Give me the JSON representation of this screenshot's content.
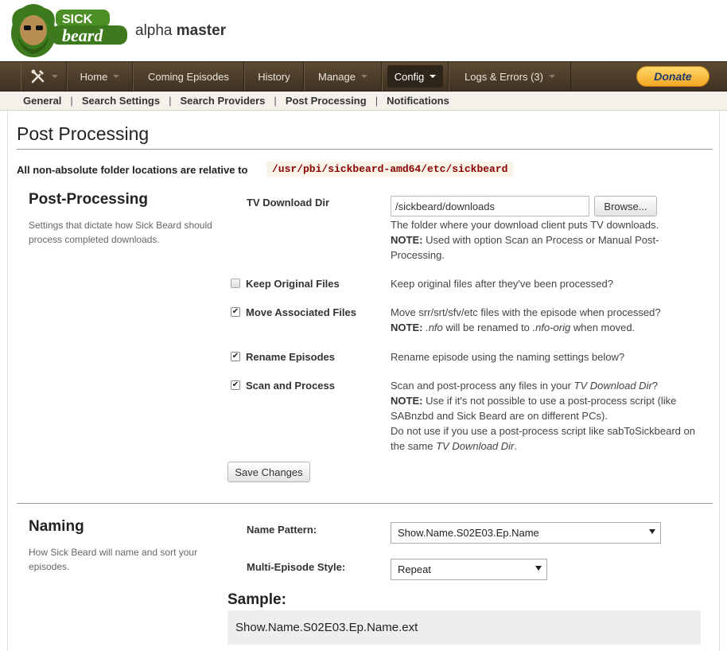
{
  "header": {
    "logo_text_top": "SICK",
    "logo_text_bottom": "beard",
    "branch_prefix": "alpha",
    "branch_name": "master"
  },
  "nav": {
    "items": [
      {
        "label": "Home"
      },
      {
        "label": "Coming Episodes"
      },
      {
        "label": "History"
      },
      {
        "label": "Manage"
      },
      {
        "label": "Config"
      },
      {
        "label": "Logs & Errors (3)"
      }
    ],
    "donate_label": "Donate"
  },
  "subnav": {
    "items": [
      "General",
      "Search Settings",
      "Search Providers",
      "Post Processing",
      "Notifications"
    ],
    "separator": "|"
  },
  "page": {
    "title": "Post Processing",
    "relative_note": "All non-absolute folder locations are relative to",
    "relative_path": "/usr/pbi/sickbeard-amd64/etc/sickbeard"
  },
  "post_processing": {
    "title": "Post-Processing",
    "description": "Settings that dictate how Sick Beard should process completed downloads.",
    "tv_download_dir": {
      "label": "TV Download Dir",
      "value": "/sickbeard/downloads",
      "browse_label": "Browse...",
      "help": "The folder where your download client puts TV downloads.",
      "note_label": "NOTE:",
      "note": "Used with option Scan an Process or Manual Post-Processing."
    },
    "keep_original": {
      "label": "Keep Original Files",
      "checked": false,
      "help": "Keep original files after they've been processed?"
    },
    "move_associated": {
      "label": "Move Associated Files",
      "checked": true,
      "help": "Move srr/srt/sfv/etc files with the episode when processed?",
      "note_label": "NOTE:",
      "note_ext1": ".nfo",
      "note_mid": "will be renamed to",
      "note_ext2": ".nfo-orig",
      "note_end": "when moved."
    },
    "rename_episodes": {
      "label": "Rename Episodes",
      "checked": true,
      "help": "Rename episode using the naming settings below?"
    },
    "scan_and_process": {
      "label": "Scan and Process",
      "checked": true,
      "help_prefix": "Scan and post-process any files in your",
      "help_dir": "TV Download Dir",
      "help_suffix": "?",
      "note_label": "NOTE:",
      "note": "Use if it's not possible to use a post-process script (like SABnzbd and Sick Beard are on different PCs).",
      "note2_prefix": "Do not use if you use a post-process script like sabToSickbeard on the same",
      "note2_dir": "TV Download Dir",
      "note2_suffix": "."
    },
    "save_label": "Save Changes"
  },
  "naming": {
    "title": "Naming",
    "description": "How Sick Beard will name and sort your episodes.",
    "name_pattern": {
      "label": "Name Pattern:",
      "value": "Show.Name.S02E03.Ep.Name"
    },
    "multi_episode_style": {
      "label": "Multi-Episode Style:",
      "value": "Repeat"
    },
    "sample_title": "Sample:",
    "sample_value": "Show.Name.S02E03.Ep.Name.ext"
  }
}
